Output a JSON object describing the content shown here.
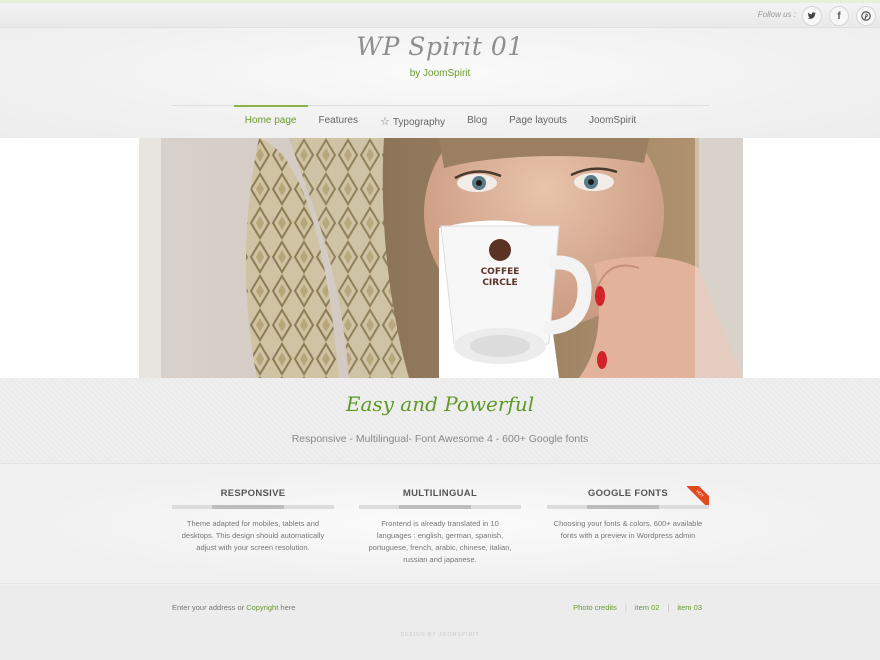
{
  "topbar": {
    "follow_label": "Follow us :",
    "social": [
      {
        "icon": "twitter-icon",
        "glyph": "🐦"
      },
      {
        "icon": "facebook-icon",
        "glyph": "f"
      },
      {
        "icon": "pinterest-icon",
        "glyph": "P"
      }
    ]
  },
  "header": {
    "site_title": "WP Spirit 01",
    "site_subtitle": "by JoomSpirit"
  },
  "nav": {
    "items": [
      {
        "label": "Home page",
        "active": true
      },
      {
        "label": "Features"
      },
      {
        "label": "Typography",
        "icon": "star-outline-icon"
      },
      {
        "label": "Blog"
      },
      {
        "label": "Page layouts"
      },
      {
        "label": "JoomSpirit"
      }
    ]
  },
  "slider": {
    "cup_logo_text_1": "COFFEE",
    "cup_logo_text_2": "CIRCLE"
  },
  "tagline": {
    "title": "Easy and Powerful",
    "subtitle": "Responsive - Multilingual- Font Awesome 4 - 600+ Google fonts"
  },
  "features": [
    {
      "title": "RESPONSIVE",
      "text": "Theme adapted for mobiles, tablets and desktops. This design should automatically adjust with your screen resolution."
    },
    {
      "title": "MULTILINGUAL",
      "text": "Frontend is already translated in 10 languages : english, german, spanish, portuguese, french, arabic, chinese, italian, russian and japanese."
    },
    {
      "title": "GOOGLE FONTS",
      "text": "Choosing your fonts & colors. 600+ available fonts with a preview in Wordpress admin",
      "badge": "HOT"
    }
  ],
  "footer": {
    "left_prefix": "Enter your address or ",
    "left_link": "Copyright",
    "left_suffix": " here",
    "links": [
      "Photo credits",
      "item 02",
      "item 03"
    ],
    "separator": "|",
    "credit": "DESIGN BY JOOMSPIRIT"
  },
  "colors": {
    "accent_green": "#6a9a2d",
    "hot_badge": "#e04a1e"
  }
}
